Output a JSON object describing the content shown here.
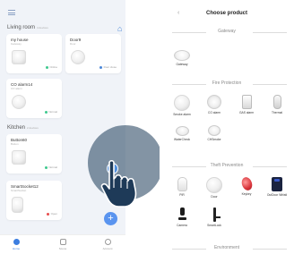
{
  "home": {
    "room_living": "Living room",
    "room_living_count": "4 devices",
    "room_kitchen": "Kitchen",
    "room_kitchen_count": "2 devices",
    "cards": [
      {
        "name": "my house",
        "sub": "Gateway",
        "status": "Online",
        "status_color": "#3ec98e"
      },
      {
        "name": "Door9",
        "sub": "Door",
        "status": "Door close",
        "status_color": "#4a87d8"
      },
      {
        "name": "CO alarm14",
        "sub": "CO alarm",
        "status": "Normal",
        "status_color": "#3ec98e"
      },
      {
        "name": "Button60",
        "sub": "Button",
        "status": "Normal",
        "status_color": "#3ec98e"
      },
      {
        "name": "SmartSocket12",
        "sub": "SmartSocket",
        "status": "Open",
        "status_color": "#e84d4d"
      }
    ],
    "fab_label": "+",
    "tabs": [
      {
        "label": "Home",
        "active": true
      },
      {
        "label": "Scene",
        "active": false
      },
      {
        "label": "Account",
        "active": false
      }
    ]
  },
  "product": {
    "back": "‹",
    "title": "Choose product",
    "sections": {
      "gateway": "Gateway",
      "fire": "Fire Protection",
      "theft": "Theft Prevention",
      "environment": "Environment"
    },
    "gateway_items": [
      {
        "label": "Gateway"
      }
    ],
    "fire_items": [
      {
        "label": "Smoke alarm"
      },
      {
        "label": "CO alarm"
      },
      {
        "label": "GAS alarm"
      },
      {
        "label": "Thermal"
      },
      {
        "label": "WaterCheck"
      },
      {
        "label": "CHSmoke"
      }
    ],
    "theft_items": [
      {
        "label": "PIR"
      },
      {
        "label": "Door"
      },
      {
        "label": "Keykey"
      },
      {
        "label": "OutDoor Whistl"
      },
      {
        "label": "Camera"
      },
      {
        "label": "SmartLock"
      }
    ]
  },
  "colors": {
    "accent": "#4a87d8",
    "online": "#3ec98e",
    "alert": "#e84d4d"
  }
}
